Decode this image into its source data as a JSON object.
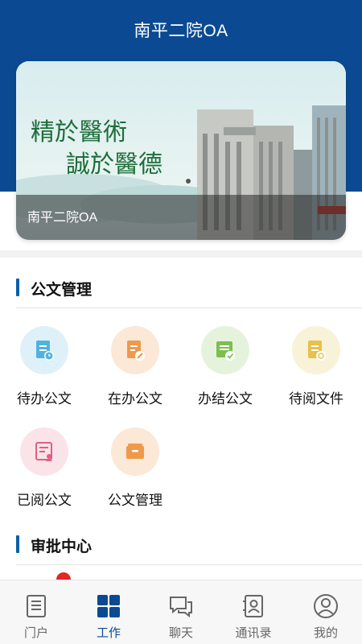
{
  "header": {
    "title": "南平二院OA"
  },
  "banner": {
    "caption": "南平二院OA",
    "calligraphy_line1": "精於醫術",
    "calligraphy_line2": "誠於醫德"
  },
  "sections": {
    "document": {
      "title": "公文管理"
    },
    "approval": {
      "title": "审批中心"
    }
  },
  "tiles": [
    {
      "label": "待办公文",
      "icon": "pending-doc-icon",
      "bg": "#dff1f8",
      "fg": "#4fb3de"
    },
    {
      "label": "在办公文",
      "icon": "in-progress-doc-icon",
      "bg": "#fbe8d6",
      "fg": "#ef9a4a"
    },
    {
      "label": "办结公文",
      "icon": "completed-doc-icon",
      "bg": "#e6f3dc",
      "fg": "#7cbf4f"
    },
    {
      "label": "待阅文件",
      "icon": "to-read-file-icon",
      "bg": "#f8f2d8",
      "fg": "#e8c04a"
    },
    {
      "label": "已阅公文",
      "icon": "read-doc-icon",
      "bg": "#fbe3ea",
      "fg": "#e0607f"
    },
    {
      "label": "公文管理",
      "icon": "doc-archive-icon",
      "bg": "#fbe8d6",
      "fg": "#ef9a4a"
    }
  ],
  "tabs": [
    {
      "label": "门户",
      "icon": "portal-icon"
    },
    {
      "label": "工作",
      "icon": "work-grid-icon",
      "active": true
    },
    {
      "label": "聊天",
      "icon": "chat-icon"
    },
    {
      "label": "通讯录",
      "icon": "contacts-icon"
    },
    {
      "label": "我的",
      "icon": "profile-icon"
    }
  ],
  "colors": {
    "header": "#0b4a92",
    "accent": "#0b5fa8",
    "badge": "#e02727"
  }
}
